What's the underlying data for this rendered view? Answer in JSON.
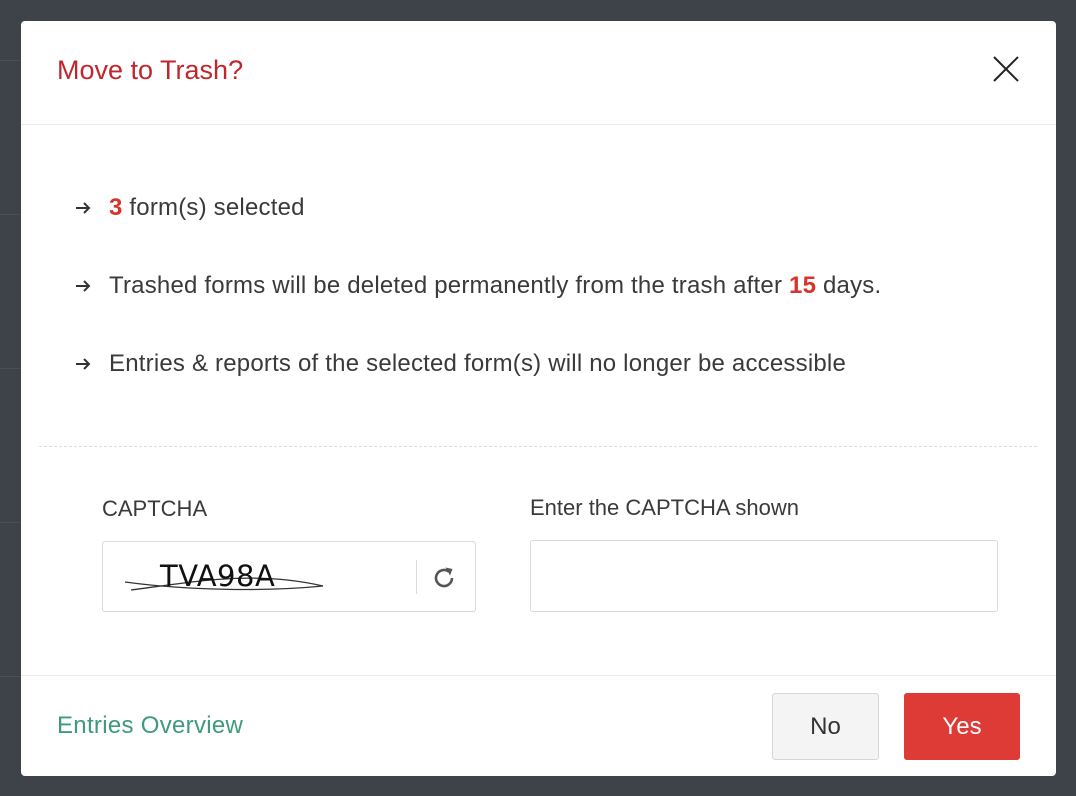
{
  "dialog": {
    "title": "Move to Trash?",
    "close_icon": "close-icon"
  },
  "info": {
    "arrow_icon": "arrow-right-icon",
    "selected_count": "3",
    "selected_suffix": " form(s) selected",
    "trash_prefix": "Trashed forms will be deleted permanently from the trash after ",
    "trash_days": "15",
    "trash_suffix": " days.",
    "entries_text": "Entries & reports of the selected form(s) will no longer be accessible"
  },
  "captcha": {
    "label": "CAPTCHA",
    "code": "TVA98A",
    "refresh_icon": "refresh-icon",
    "input_label": "Enter the CAPTCHA shown",
    "input_value": "",
    "input_placeholder": ""
  },
  "footer": {
    "link_label": "Entries Overview",
    "no_label": "No",
    "yes_label": "Yes"
  },
  "colors": {
    "title": "#c0262d",
    "highlight": "#d9342c",
    "link": "#3d9b7a",
    "primary_button": "#de3a36",
    "backdrop": "#3e434a"
  }
}
